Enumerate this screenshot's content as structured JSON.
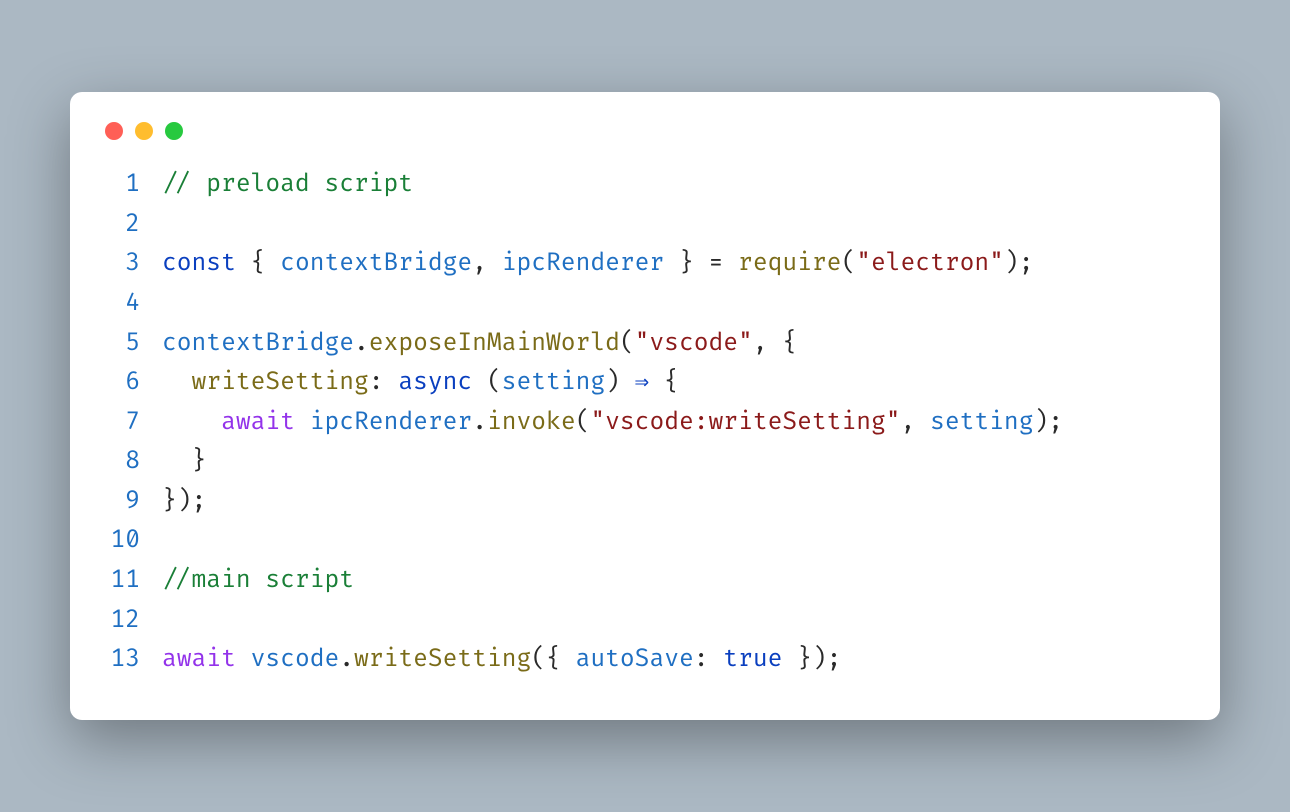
{
  "colors": {
    "background": "#abb8c3",
    "window": "#ffffff",
    "red": "#ff5f56",
    "yellow": "#ffbd2e",
    "green": "#27c93f",
    "lineNumber": "#1f6fc2",
    "comment": "#1a7f37",
    "keyword": "#0a3fbf",
    "keyword2": "#9333ea",
    "identifier": "#1f6fc2",
    "function": "#7a6b18",
    "string": "#8b1a1a",
    "punct": "#2a2a2a"
  },
  "lineCount": 13,
  "ln": [
    "1",
    "2",
    "3",
    "4",
    "5",
    "6",
    "7",
    "8",
    "9",
    "10",
    "11",
    "12",
    "13"
  ],
  "code": {
    "l1": {
      "c1": "// preload script"
    },
    "l3": {
      "t1": "const",
      "t2": " { ",
      "t3": "contextBridge",
      "t4": ", ",
      "t5": "ipcRenderer",
      "t6": " } = ",
      "t7": "require",
      "t8": "(",
      "t9": "\"electron\"",
      "t10": ");"
    },
    "l5": {
      "t1": "contextBridge",
      "t2": ".",
      "t3": "exposeInMainWorld",
      "t4": "(",
      "t5": "\"vscode\"",
      "t6": ", {"
    },
    "l6": {
      "t0": "  ",
      "t1": "writeSetting",
      "t2": ": ",
      "t3": "async",
      "t4": " (",
      "t5": "setting",
      "t6": ") ",
      "t7": "⇒",
      "t8": " {"
    },
    "l7": {
      "t0": "    ",
      "t1": "await",
      "t2": " ",
      "t3": "ipcRenderer",
      "t4": ".",
      "t5": "invoke",
      "t6": "(",
      "t7": "\"vscode:writeSetting\"",
      "t8": ", ",
      "t9": "setting",
      "t10": ");"
    },
    "l8": {
      "t0": "  ",
      "t1": "}"
    },
    "l9": {
      "t1": "});"
    },
    "l11": {
      "c1": "//main script"
    },
    "l13": {
      "t1": "await",
      "t2": " ",
      "t3": "vscode",
      "t4": ".",
      "t5": "writeSetting",
      "t6": "({ ",
      "t7": "autoSave",
      "t8": ": ",
      "t9": "true",
      "t10": " });"
    }
  }
}
